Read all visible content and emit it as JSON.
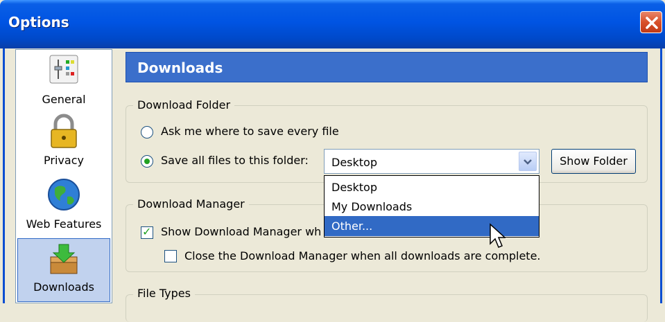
{
  "window": {
    "title": "Options"
  },
  "nav": {
    "items": [
      {
        "label": "General",
        "icon": "sliders-icon"
      },
      {
        "label": "Privacy",
        "icon": "padlock-icon"
      },
      {
        "label": "Web Features",
        "icon": "globe-icon"
      },
      {
        "label": "Downloads",
        "icon": "downloads-icon",
        "selected": true
      }
    ]
  },
  "panel": {
    "title": "Downloads"
  },
  "download_folder": {
    "legend": "Download Folder",
    "ask_label": "Ask me where to save every file",
    "save_label": "Save all files to this folder:",
    "selected_option": "save",
    "folder_value": "Desktop",
    "show_folder_label": "Show Folder",
    "dropdown_options": [
      "Desktop",
      "My Downloads",
      "Other..."
    ],
    "highlighted_option": "Other..."
  },
  "download_manager": {
    "legend": "Download Manager",
    "show_label": "Show Download Manager wh",
    "show_checked": true,
    "close_label": "Close the Download Manager when all downloads are complete.",
    "close_checked": false
  },
  "file_types": {
    "legend": "File Types"
  },
  "colors": {
    "titlebar": "#0054e3",
    "header": "#3b6fcb",
    "highlight": "#316ac5",
    "close": "#d8502a"
  }
}
